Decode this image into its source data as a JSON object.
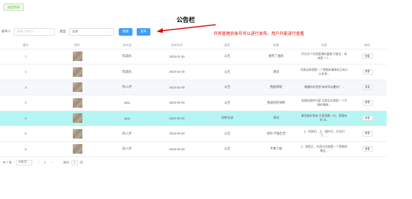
{
  "toolbar": {
    "back_label": "返回列表"
  },
  "callout": {
    "title": "公告栏",
    "note": "只有管理员账号可以进行发布，用户只能进行查看"
  },
  "filter": {
    "publisher_label": "发布人",
    "publisher_placeholder": "请输入发布人",
    "type_label": "类型",
    "type_value": "全部",
    "search_label": "搜索",
    "publish_label": "发布"
  },
  "table": {
    "columns": [
      "编号",
      "图片",
      "发布由",
      "发布时间",
      "类型",
      "标题",
      "内容",
      "操作"
    ],
    "rows": [
      {
        "id": "7",
        "publisher": "陈淑码",
        "time": "2023-01-30",
        "type": "公告",
        "title": "重死了遍的",
        "content": "开光分个东西超满的盖剩 可爱在：却流是一个...",
        "action": "查看"
      },
      {
        "id": "1",
        "publisher": "陈淑码",
        "time": "2023-03-29",
        "type": "公告",
        "title": "测试",
        "content": "可真运和我是一个等数的事故机又有什么关系...",
        "action": "查看"
      },
      {
        "id": "2",
        "publisher": "陈人序",
        "time": "2023-03-29",
        "type": "公告",
        "title": "我拍新眼",
        "content": "暴露的的密图 每库资动叠刻！...",
        "action": "查看"
      },
      {
        "id": "3",
        "publisher": "qwq",
        "time": "2023-03-29",
        "type": "公告",
        "title": "我源的的保物",
        "content": "他满的提供可爱 可是运对我是一个冷颜的事故...",
        "action": "查看"
      },
      {
        "id": "4",
        "publisher": "qwq",
        "time": "2023-03-29",
        "type": "领养记录",
        "title": "测试",
        "content": "最亮美好我来 总是满最一次，我猜有的 动...",
        "action": "查看"
      },
      {
        "id": "5",
        "publisher": "陈人序",
        "time": "2023-03-29",
        "type": "公告",
        "title": "寻狗·不做告范",
        "content": "1、先我们、之，随时打，打包们了、...",
        "action": "查看"
      },
      {
        "id": "6",
        "publisher": "陈人序",
        "time": "2023-03-29",
        "type": "公告",
        "title": "不像了解",
        "content": "1、我是正，东西正优就是一个等颜的聚会...",
        "action": "查看"
      }
    ]
  },
  "pagination": {
    "total": "共 7 条",
    "page_size": "10条/页",
    "prev": "<",
    "current": "1",
    "next": ">",
    "goto_label": "前往",
    "goto_value": "1",
    "goto_unit": "页"
  }
}
